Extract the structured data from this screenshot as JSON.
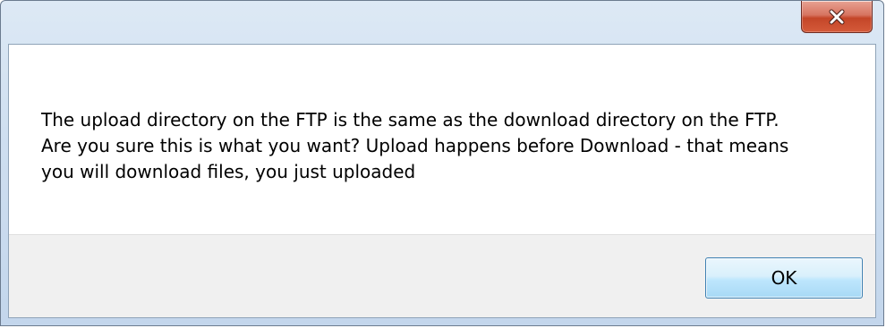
{
  "dialog": {
    "title": "",
    "close_icon": "close-icon",
    "close_button_color": "#c44628",
    "message": "The upload directory on the FTP is the same as the download directory on the FTP. Are you sure this is what you want? Upload happens before Download - that means you will download files, you just uploaded",
    "ok_label": "OK"
  }
}
